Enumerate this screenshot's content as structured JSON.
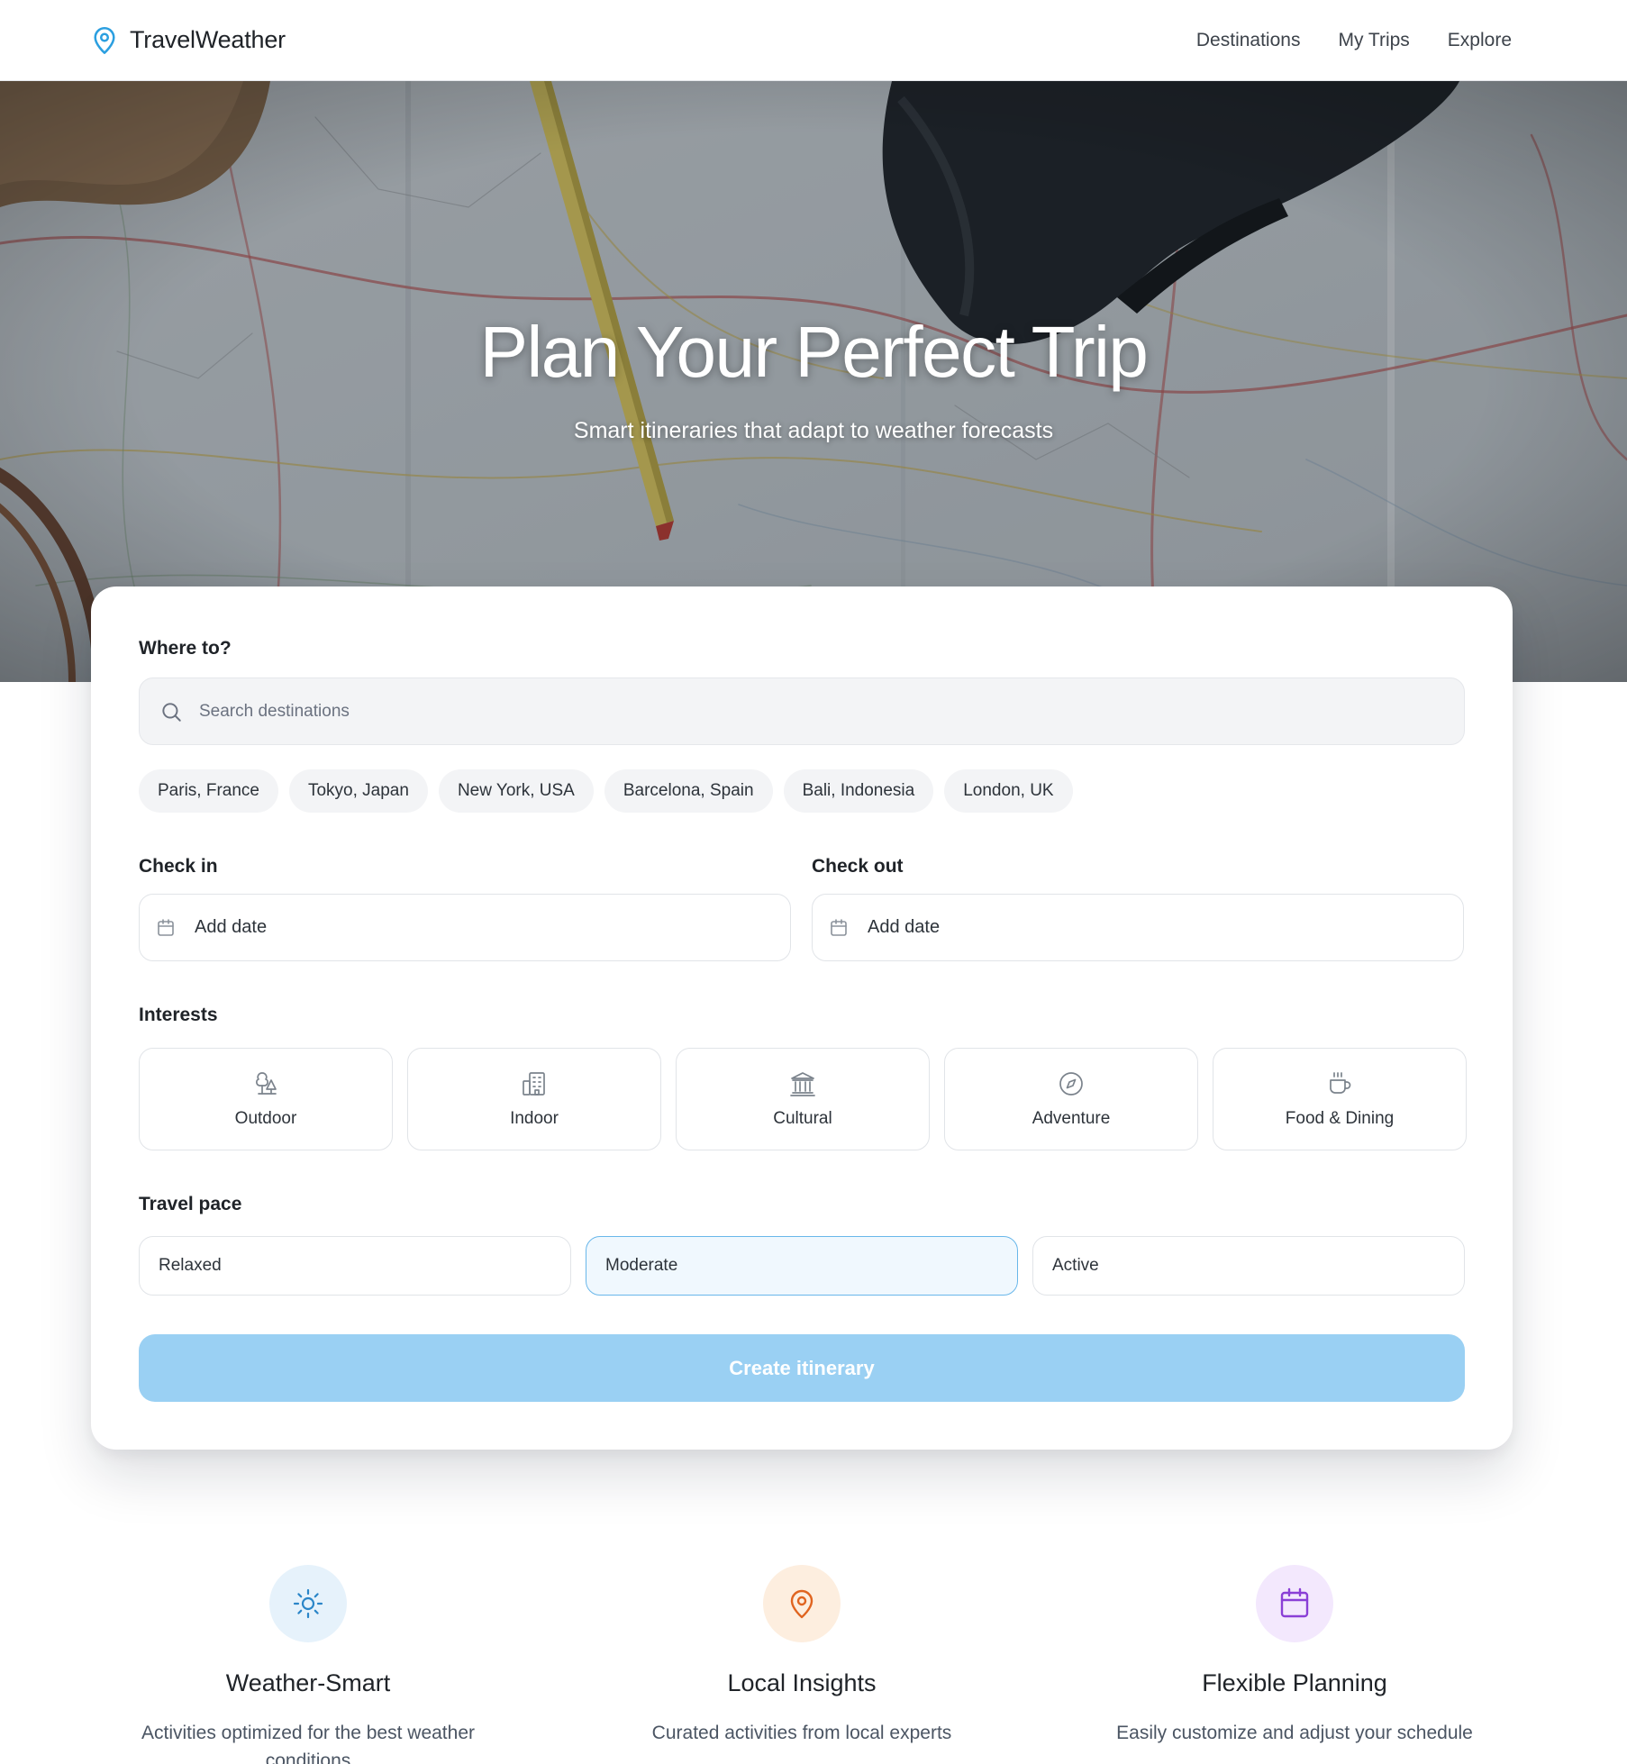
{
  "header": {
    "brand": "TravelWeather",
    "nav": [
      "Destinations",
      "My Trips",
      "Explore"
    ]
  },
  "hero": {
    "title": "Plan Your Perfect Trip",
    "subtitle": "Smart itineraries that adapt to weather forecasts"
  },
  "form": {
    "where_label": "Where to?",
    "search_placeholder": "Search destinations",
    "destinations": [
      "Paris, France",
      "Tokyo, Japan",
      "New York, USA",
      "Barcelona, Spain",
      "Bali, Indonesia",
      "London, UK"
    ],
    "checkin_label": "Check in",
    "checkin_value": "Add date",
    "checkout_label": "Check out",
    "checkout_value": "Add date",
    "interests_label": "Interests",
    "interests": [
      {
        "label": "Outdoor",
        "icon": "trees-icon"
      },
      {
        "label": "Indoor",
        "icon": "building-icon"
      },
      {
        "label": "Cultural",
        "icon": "landmark-icon"
      },
      {
        "label": "Adventure",
        "icon": "compass-icon"
      },
      {
        "label": "Food & Dining",
        "icon": "coffee-icon"
      }
    ],
    "pace_label": "Travel pace",
    "paces": [
      "Relaxed",
      "Moderate",
      "Active"
    ],
    "selected_pace": "Moderate",
    "submit_label": "Create itinerary"
  },
  "features": [
    {
      "title": "Weather-Smart",
      "description": "Activities optimized for the best weather conditions",
      "icon": "sun-icon",
      "color": "#2b86c8",
      "bg": "#e6f2fb"
    },
    {
      "title": "Local Insights",
      "description": "Curated activities from local experts",
      "icon": "map-pin-icon",
      "color": "#e0641f",
      "bg": "#fdeedf"
    },
    {
      "title": "Flexible Planning",
      "description": "Easily customize and adjust your schedule",
      "icon": "calendar-icon",
      "color": "#8a3fd6",
      "bg": "#f3e8fd"
    }
  ],
  "colors": {
    "accent": "#2b9fe0",
    "button": "#9ad0f3",
    "selected_border": "#69b7ea"
  }
}
